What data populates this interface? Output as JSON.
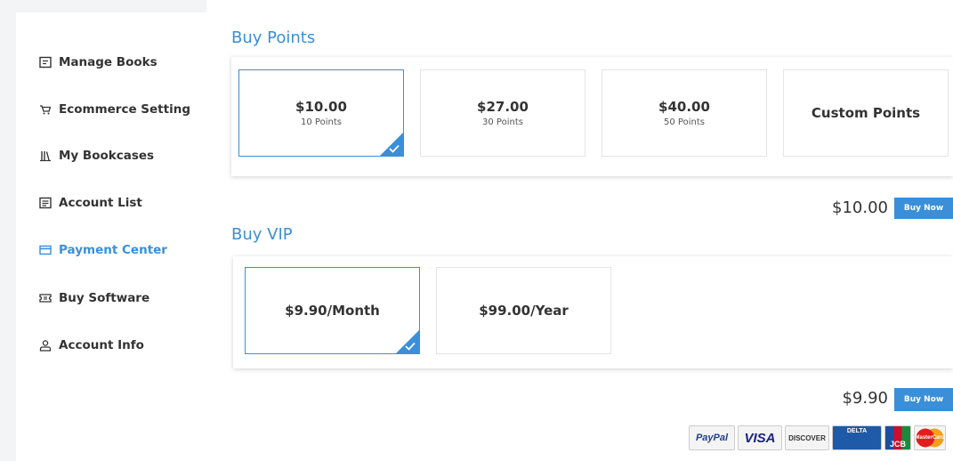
{
  "sidebar": {
    "items": [
      {
        "label": "Manage Books",
        "icon": "book-manage-icon",
        "active": false
      },
      {
        "label": "Ecommerce Setting",
        "icon": "cart-icon",
        "active": false
      },
      {
        "label": "My Bookcases",
        "icon": "bookcase-icon",
        "active": false
      },
      {
        "label": "Account List",
        "icon": "list-icon",
        "active": false
      },
      {
        "label": "Payment Center",
        "icon": "card-icon",
        "active": true
      },
      {
        "label": "Buy Software",
        "icon": "ticket-icon",
        "active": false
      },
      {
        "label": "Account Info",
        "icon": "user-icon",
        "active": false
      }
    ]
  },
  "points": {
    "title": "Buy Points",
    "options": [
      {
        "price": "$10.00",
        "points": "10 Points",
        "selected": true
      },
      {
        "price": "$27.00",
        "points": "30 Points",
        "selected": false
      },
      {
        "price": "$40.00",
        "points": "50 Points",
        "selected": false
      },
      {
        "label": "Custom Points",
        "selected": false
      }
    ],
    "total": "$10.00",
    "buy_label": "Buy Now"
  },
  "vip": {
    "title": "Buy VIP",
    "options": [
      {
        "label": "$9.90/Month",
        "selected": true
      },
      {
        "label": "$99.00/Year",
        "selected": false
      }
    ],
    "total": "$9.90",
    "buy_label": "Buy Now"
  },
  "payment_logos": [
    "PayPal",
    "VISA",
    "DISCOVER",
    "DELTA",
    "JCB",
    "MasterCard"
  ],
  "colors": {
    "accent": "#3a8fd8",
    "sidebar_bg": "#ffffff",
    "page_bg": "#f3f4f6"
  }
}
